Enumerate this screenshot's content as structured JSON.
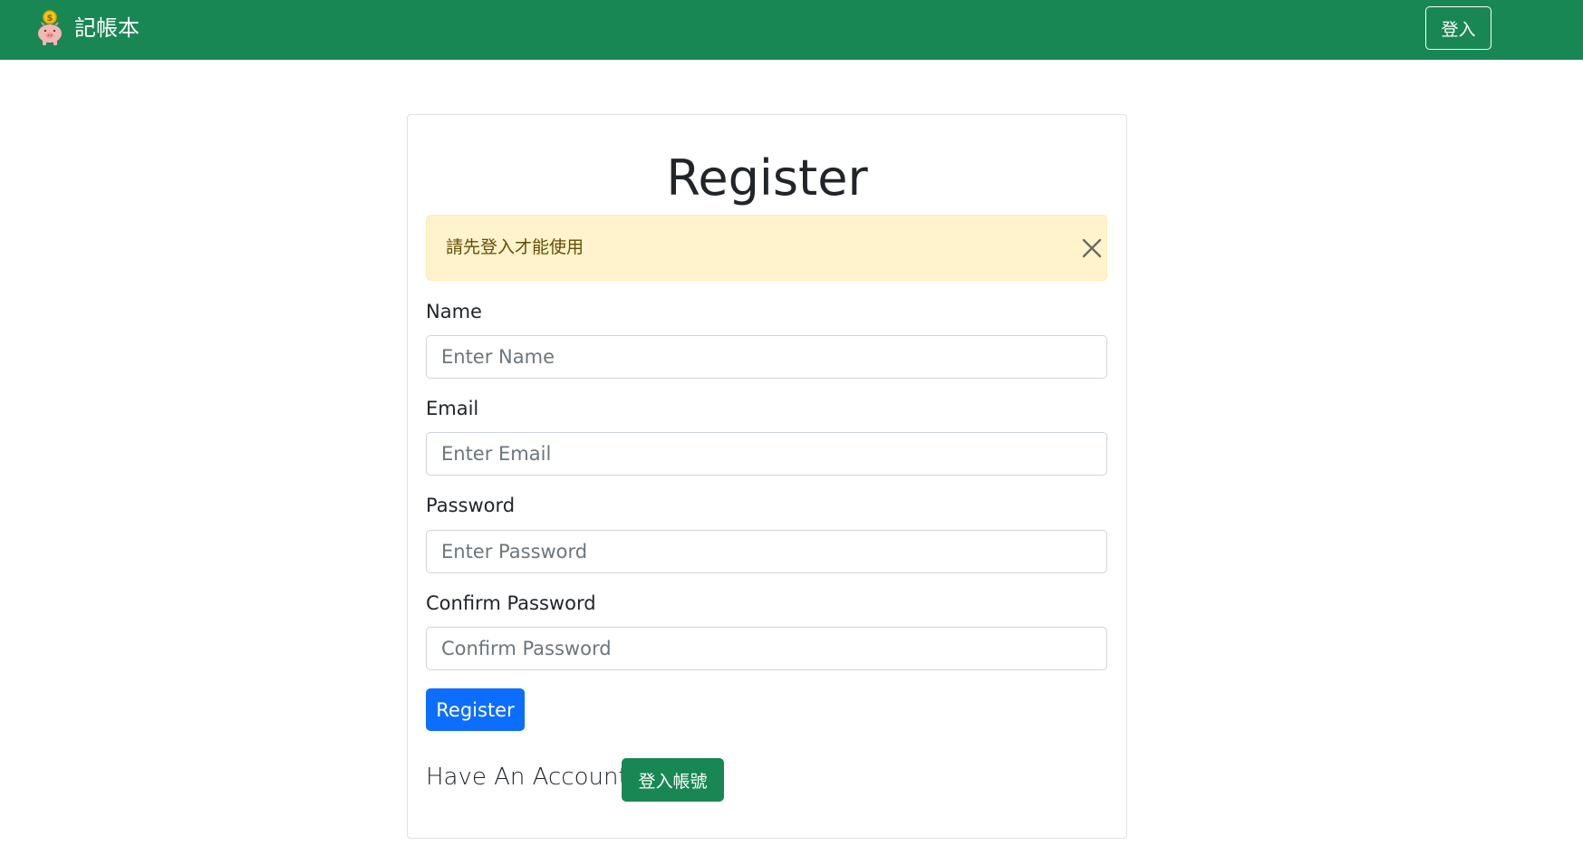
{
  "navbar": {
    "brand_text": "記帳本",
    "brand_icon": "piggy-bank-icon",
    "login_label": "登入",
    "background_color": "#198754"
  },
  "card": {
    "title": "Register",
    "alert": {
      "message": "請先登入才能使用",
      "close_icon": "close-icon",
      "background_color": "#fff3cd"
    },
    "fields": {
      "name": {
        "label": "Name",
        "placeholder": "Enter Name"
      },
      "email": {
        "label": "Email",
        "placeholder": "Enter Email"
      },
      "password": {
        "label": "Password",
        "placeholder": "Enter Password"
      },
      "confirm_password": {
        "label": "Confirm Password",
        "placeholder": "Confirm Password"
      }
    },
    "register_label": "Register",
    "register_color": "#0d6efd",
    "have_account_text": "Have An Account?",
    "login_account_label": "登入帳號",
    "login_account_color": "#198754"
  }
}
